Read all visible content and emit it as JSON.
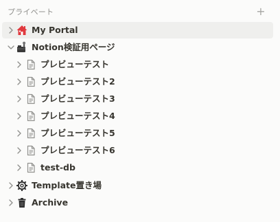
{
  "section": {
    "title": "プライベート",
    "add_label": "+"
  },
  "items": [
    {
      "label": "My Portal",
      "icon": "house-icon"
    },
    {
      "label": "Notion検証用ページ",
      "icon": "toolbox-icon"
    },
    {
      "label": "プレビューテスト",
      "icon": "page-icon"
    },
    {
      "label": "プレビューテスト2",
      "icon": "page-icon"
    },
    {
      "label": "プレビューテスト3",
      "icon": "page-icon"
    },
    {
      "label": "プレビューテスト4",
      "icon": "page-icon"
    },
    {
      "label": "プレビューテスト5",
      "icon": "page-icon"
    },
    {
      "label": "プレビューテスト6",
      "icon": "page-icon"
    },
    {
      "label": "test-db",
      "icon": "page-icon"
    },
    {
      "label": "Template置き場",
      "icon": "gear-icon"
    },
    {
      "label": "Archive",
      "icon": "trash-icon"
    }
  ]
}
